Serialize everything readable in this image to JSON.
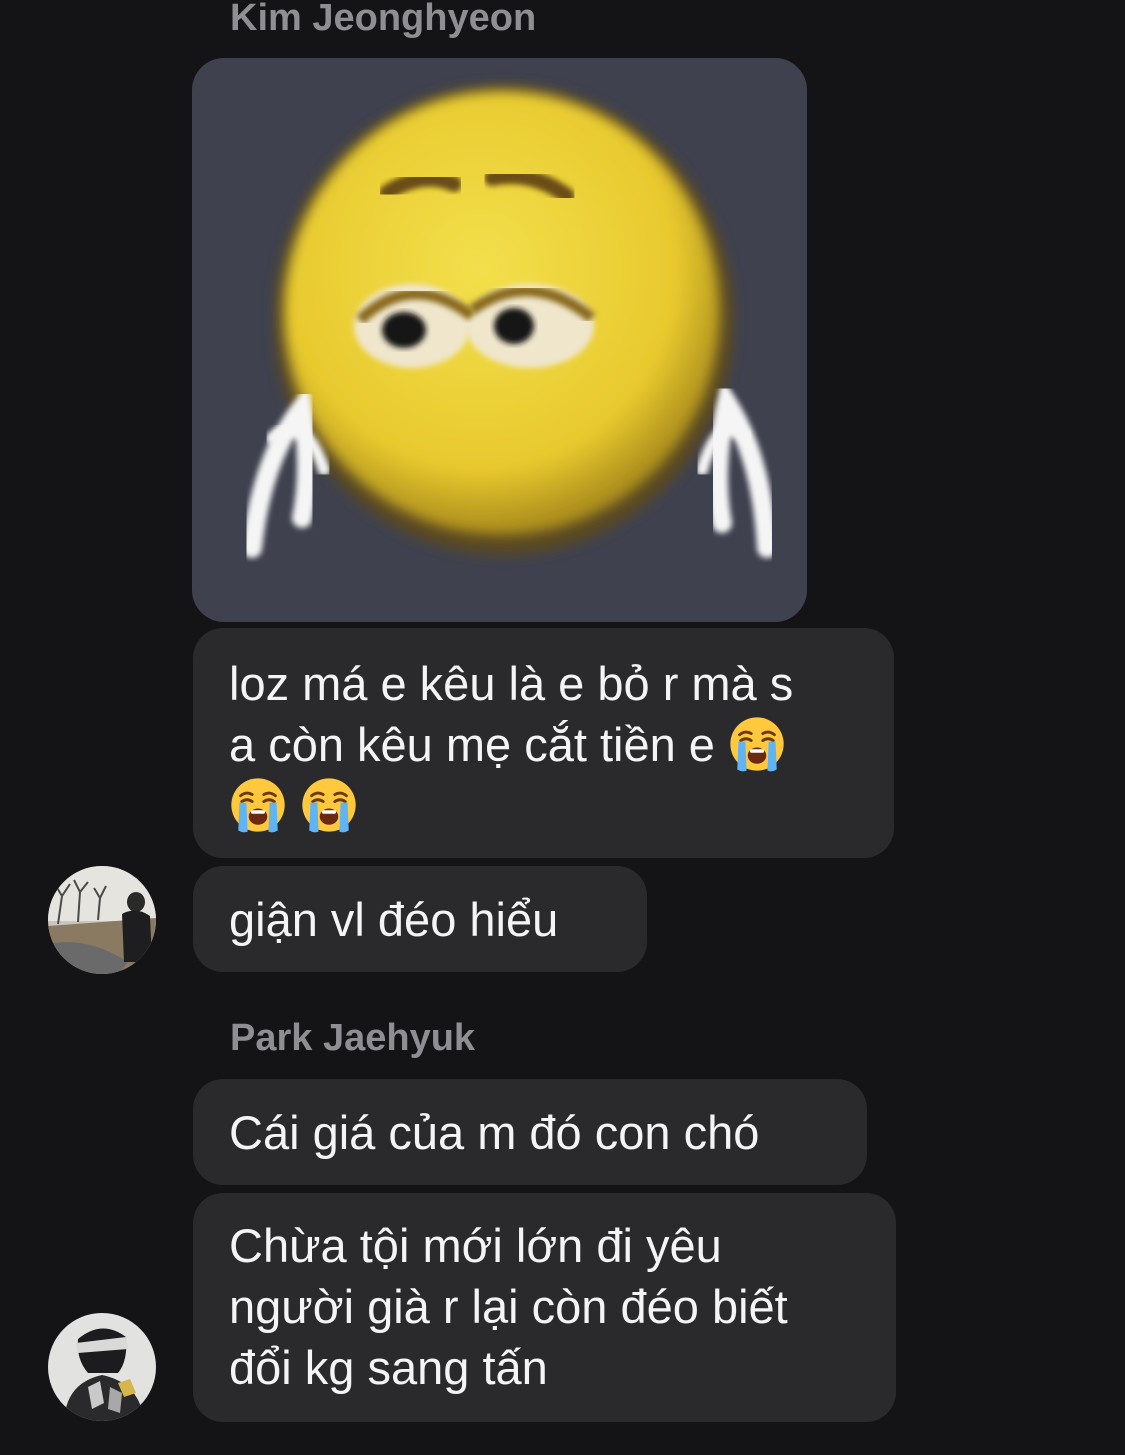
{
  "conversation": {
    "groups": [
      {
        "sender": "Kim Jeonghyeon",
        "image_message": "crying-emoji-meme",
        "messages": [
          {
            "lines": [
              "loz má e kêu là e bỏ r mà s",
              "a còn kêu mẹ cắt tiền e"
            ],
            "emojis": [
              "loudly-crying-face",
              "loudly-crying-face",
              "loudly-crying-face"
            ]
          },
          {
            "lines": [
              "giận vl đéo hiểu"
            ]
          }
        ],
        "avatar": "avatar-park-photo"
      },
      {
        "sender": "Park Jaehyuk",
        "messages": [
          {
            "lines": [
              "Cái giá của m đó con chó"
            ]
          },
          {
            "lines": [
              "Chừa tội mới lớn đi yêu",
              "người già r lại còn đéo biết",
              "đổi kg sang tấn"
            ]
          }
        ],
        "avatar": "avatar-hand-over-face-photo"
      }
    ]
  },
  "colors": {
    "background": "#141416",
    "bubble": "#2a2a2d",
    "sender_name": "#8e8e93",
    "message_text": "#f4f4f6"
  }
}
